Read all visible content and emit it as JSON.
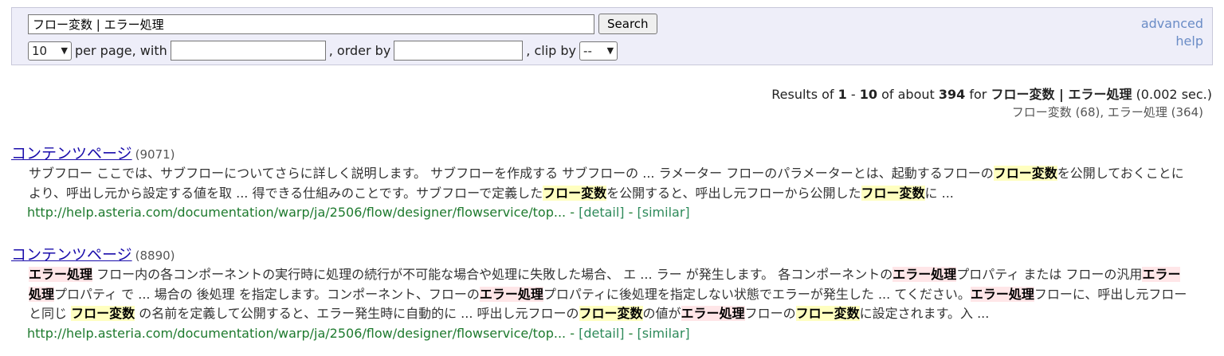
{
  "search": {
    "query": "フロー変数 | エラー処理",
    "button": "Search",
    "per_page_value": "10",
    "per_page_text": "per page, with",
    "order_text": ", order by",
    "clip_text": ", clip by",
    "clip_value": "--",
    "advanced": "advanced",
    "help": "help"
  },
  "summary": {
    "prefix": "Results of",
    "from": "1",
    "dash": "-",
    "to": "10",
    "of_about": "of about",
    "total": "394",
    "for": "for",
    "query": "フロー変数 | エラー処理",
    "time": "(0.002 sec.)",
    "term_counts": "フロー変数 (68), エラー処理 (364)"
  },
  "results": [
    {
      "title": "コンテンツページ",
      "count": "(9071)",
      "url": "http://help.asteria.com/documentation/warp/ja/2506/flow/designer/flowservice/top...",
      "detail": "[detail]",
      "similar": "[similar]",
      "sep": "-"
    },
    {
      "title": "コンテンツページ",
      "count": "(8890)",
      "url": "http://help.asteria.com/documentation/warp/ja/2506/flow/designer/flowservice/top...",
      "detail": "[detail]",
      "similar": "[similar]",
      "sep": "-"
    }
  ],
  "snippets": {
    "r1": [
      "サブフロー ここでは、サブフローについてさらに詳しく説明します。 サブフローを作成する サブフローの ... ラメーター フローのパラメーターとは、起動するフローの",
      "フロー変数",
      "を公開しておくことにより、呼出し元から設定する値を取 ... 得できる仕組みのことです。サブフローで定義した",
      "フロー変数",
      "を公開すると、呼出し元フローから公開した",
      "フロー変数",
      "に ..."
    ],
    "r2": [
      "エラー処理",
      " フロー内の各コンポーネントの実行時に処理の続行が不可能な場合や処理に失敗した場合、 エ ... ラー が発生します。 各コンポーネントの",
      "エラー処理",
      "プロパティ または フローの汎用",
      "エラー処理",
      "プロパティ で ... 場合の 後処理 を指定します。コンポーネント、フローの",
      "エラー処理",
      "プロパティに後処理を指定しない状態でエラーが発生した ... てください。",
      "エラー処理",
      "フローに、呼出し元フローと同じ ",
      "フロー変数",
      " の名前を定義して公開すると、エラー発生時に自動的に ... 呼出し元フローの",
      "フロー変数",
      "の値が",
      "エラー処理",
      "フローの",
      "フロー変数",
      "に設定されます。入 ..."
    ]
  },
  "colors": {
    "title_link": "#1a0dab",
    "url": "#1e7a2e",
    "highlight_flow_var": "#ffffc0",
    "highlight_error": "#ffe6e8",
    "search_panel": "#eeeef9"
  }
}
